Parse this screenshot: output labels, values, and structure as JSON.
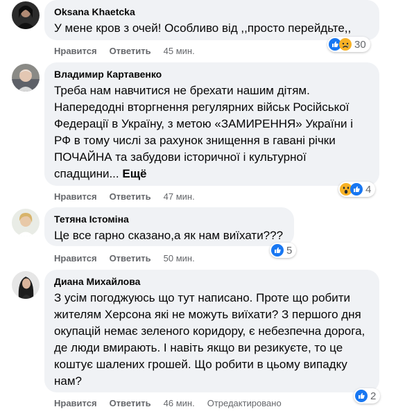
{
  "labels": {
    "like": "Нравится",
    "reply": "Ответить",
    "more": "Ещё"
  },
  "colors": {
    "like_blue": "#1877f2",
    "bubble_bg": "#f0f2f5",
    "meta_gray": "#65676b"
  },
  "comments": [
    {
      "author": "Oksana Khaetcka",
      "text": "У мене кров з очей! Особливо від ,,просто перейдьте,,",
      "time": "45 мин.",
      "reactions": {
        "icons": [
          "like-icon",
          "sad-icon"
        ],
        "count": "30"
      }
    },
    {
      "author": "Владимир Картавенко",
      "text": "Треба нам навчитися не брехати нашим дітям.\nНапередодні вторгнення регулярних військ Російської Федерації в Україну, з метою «ЗАМИРЕННЯ» України і РФ в тому числі за рахунок знищення в гавані річки ПОЧАЙНА та забудови історичної і культурної спадщини...",
      "time": "47 мин.",
      "reactions": {
        "icons": [
          "wow-icon",
          "like-icon"
        ],
        "count": "4"
      }
    },
    {
      "author": "Тетяна Істоміна",
      "text": "Це все гарно сказано,а як нам виїхати???",
      "time": "50 мин.",
      "reactions": {
        "icons": [
          "like-icon"
        ],
        "count": "5"
      }
    },
    {
      "author": "Диана Михайлова",
      "text": "З усім погоджуюсь що тут написано. Проте що робити жителям Херсона які не можуть виїхати? З першого дня окупацій немає зеленого коридору, є небезпечна дорога, де люди вмирають. І навіть якщо ви резикуєте, то це коштує шалених грошей. Що робити в цьому випадку нам?",
      "time": "46 мин.",
      "edited": "Отредактировано",
      "reactions": {
        "icons": [
          "like-icon"
        ],
        "count": "2"
      }
    }
  ]
}
